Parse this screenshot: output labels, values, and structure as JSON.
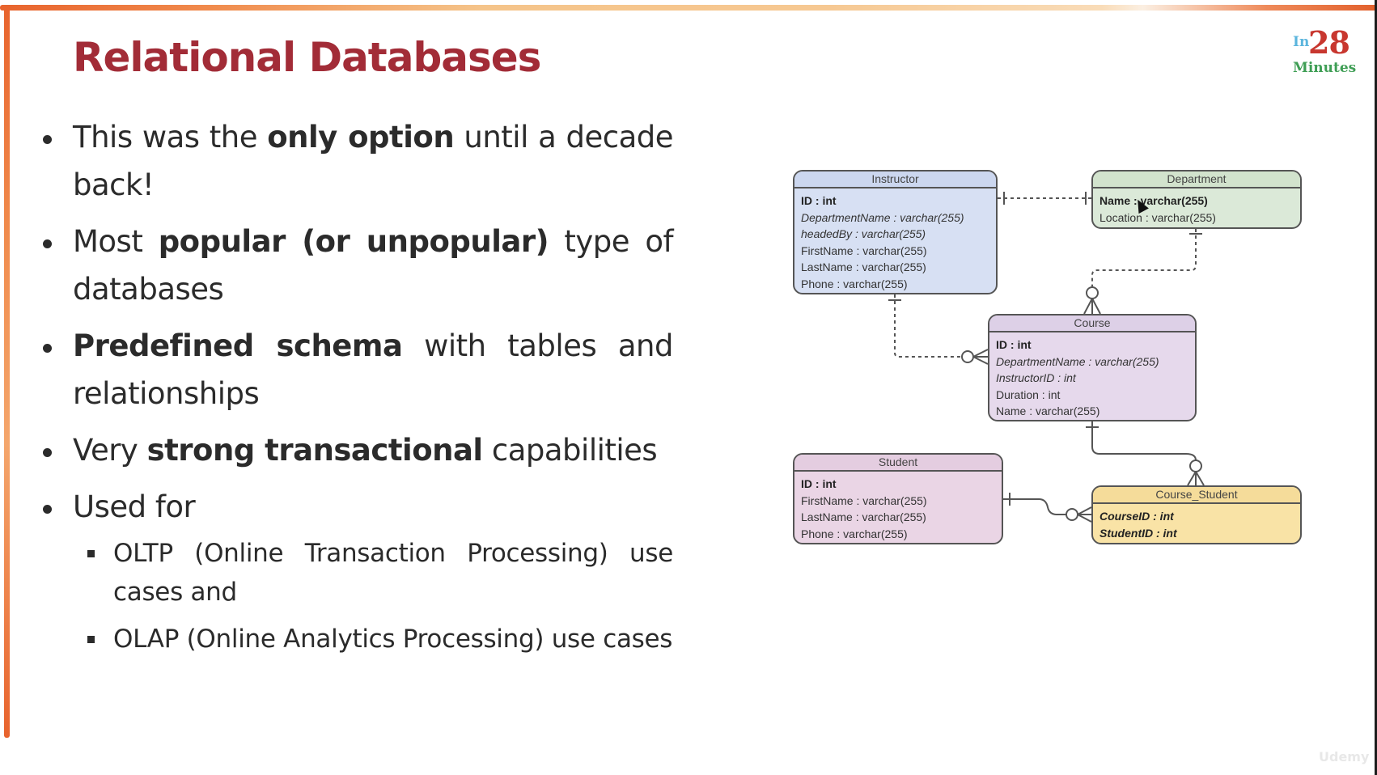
{
  "slide": {
    "title": "Relational Databases",
    "logo": {
      "prefix": "In",
      "number": "28",
      "suffix": "Minutes"
    },
    "watermark": "Udemy",
    "accent_colors": {
      "title": "#a22c37",
      "frame": "#e8632d"
    }
  },
  "bullets": [
    {
      "parts": [
        {
          "text": "This was the ",
          "bold": false
        },
        {
          "text": "only option",
          "bold": true
        },
        {
          "text": " until a decade back!",
          "bold": false
        }
      ]
    },
    {
      "parts": [
        {
          "text": "Most ",
          "bold": false
        },
        {
          "text": "popular (or unpopular)",
          "bold": true
        },
        {
          "text": " type of databases",
          "bold": false
        }
      ]
    },
    {
      "parts": [
        {
          "text": "Predefined schema",
          "bold": true
        },
        {
          "text": " with tables and relationships",
          "bold": false
        }
      ]
    },
    {
      "parts": [
        {
          "text": "Very ",
          "bold": false
        },
        {
          "text": "strong transactional",
          "bold": true
        },
        {
          "text": " capabilities",
          "bold": false
        }
      ]
    },
    {
      "parts": [
        {
          "text": "Used for",
          "bold": false
        }
      ]
    }
  ],
  "sub_bullets": [
    "OLTP (Online Transaction Processing) use cases and",
    "OLAP (Online Analytics Processing) use cases"
  ],
  "er_diagram": {
    "entities": {
      "instructor": {
        "name": "Instructor",
        "attributes": [
          {
            "text": "ID : int",
            "kind": "pk"
          },
          {
            "text": "DepartmentName : varchar(255)",
            "kind": "fk"
          },
          {
            "text": "headedBy : varchar(255)",
            "kind": "fk"
          },
          {
            "text": "FirstName : varchar(255)",
            "kind": "plain"
          },
          {
            "text": "LastName : varchar(255)",
            "kind": "plain"
          },
          {
            "text": "Phone : varchar(255)",
            "kind": "plain"
          }
        ]
      },
      "department": {
        "name": "Department",
        "attributes": [
          {
            "text": "Name : varchar(255)",
            "kind": "pk"
          },
          {
            "text": "Location : varchar(255)",
            "kind": "plain"
          }
        ]
      },
      "course": {
        "name": "Course",
        "attributes": [
          {
            "text": "ID : int",
            "kind": "pk"
          },
          {
            "text": "DepartmentName : varchar(255)",
            "kind": "fk"
          },
          {
            "text": "InstructorID : int",
            "kind": "fk"
          },
          {
            "text": "Duration : int",
            "kind": "plain"
          },
          {
            "text": "Name : varchar(255)",
            "kind": "plain"
          }
        ]
      },
      "student": {
        "name": "Student",
        "attributes": [
          {
            "text": "ID : int",
            "kind": "pk"
          },
          {
            "text": "FirstName : varchar(255)",
            "kind": "plain"
          },
          {
            "text": "LastName : varchar(255)",
            "kind": "plain"
          },
          {
            "text": "Phone : varchar(255)",
            "kind": "plain"
          }
        ]
      },
      "course_student": {
        "name": "Course_Student",
        "attributes": [
          {
            "text": "CourseID : int",
            "kind": "pkfk"
          },
          {
            "text": "StudentID : int",
            "kind": "pkfk"
          }
        ]
      }
    },
    "relationships": [
      {
        "from": "Instructor",
        "to": "Department",
        "type": "one-to-one",
        "style": "dashed"
      },
      {
        "from": "Department",
        "to": "Course",
        "type": "one-to-zero-or-many",
        "style": "dashed"
      },
      {
        "from": "Instructor",
        "to": "Course",
        "type": "one-to-zero-or-many",
        "style": "dashed"
      },
      {
        "from": "Course",
        "to": "Course_Student",
        "type": "one-to-zero-or-many",
        "style": "solid"
      },
      {
        "from": "Student",
        "to": "Course_Student",
        "type": "one-to-zero-or-many",
        "style": "solid"
      }
    ]
  }
}
